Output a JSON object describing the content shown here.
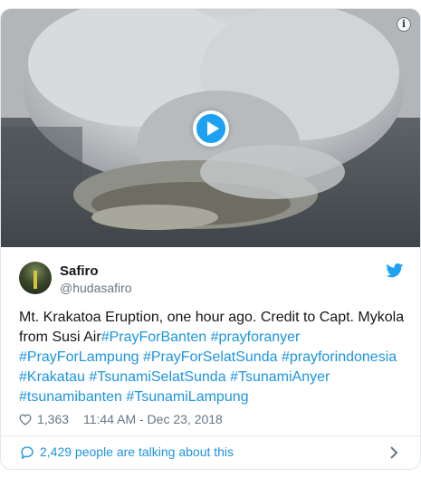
{
  "tweet": {
    "author": {
      "name": "Safiro",
      "handle": "@hudasafiro"
    },
    "text_parts": [
      {
        "type": "text",
        "value": "Mt. Krakatoa Eruption, one hour ago. Credit to Capt. Mykola from Susi Air"
      },
      {
        "type": "hashtag",
        "value": "#PrayForBanten"
      },
      {
        "type": "text",
        "value": " "
      },
      {
        "type": "hashtag",
        "value": "#prayforanyer"
      },
      {
        "type": "text",
        "value": " "
      },
      {
        "type": "hashtag",
        "value": "#PrayForLampung"
      },
      {
        "type": "text",
        "value": " "
      },
      {
        "type": "hashtag",
        "value": "#PrayForSelatSunda"
      },
      {
        "type": "text",
        "value": " "
      },
      {
        "type": "hashtag",
        "value": "#prayforindonesia"
      },
      {
        "type": "text",
        "value": " "
      },
      {
        "type": "hashtag",
        "value": "#Krakatau"
      },
      {
        "type": "text",
        "value": " "
      },
      {
        "type": "hashtag",
        "value": "#TsunamiSelatSunda"
      },
      {
        "type": "text",
        "value": " "
      },
      {
        "type": "hashtag",
        "value": "#TsunamiAnyer"
      },
      {
        "type": "text",
        "value": " "
      },
      {
        "type": "hashtag",
        "value": "#tsunamibanten"
      },
      {
        "type": "text",
        "value": " "
      },
      {
        "type": "hashtag",
        "value": "#TsunamiLampung"
      }
    ],
    "likes": "1,363",
    "timestamp": "11:44 AM - Dec 23, 2018",
    "talking": "2,429 people are talking about this"
  },
  "media": {
    "type": "video",
    "play_icon": "play-icon",
    "info_icon": "info-icon"
  },
  "icons": {
    "brand": "twitter-bird-icon",
    "like": "heart-icon",
    "reply": "speech-bubble-icon",
    "more": "chevron-right-icon"
  },
  "colors": {
    "link": "#1b95e0",
    "twitter_blue": "#1da1f2",
    "secondary_text": "#657786",
    "border": "#e1e8ed"
  }
}
